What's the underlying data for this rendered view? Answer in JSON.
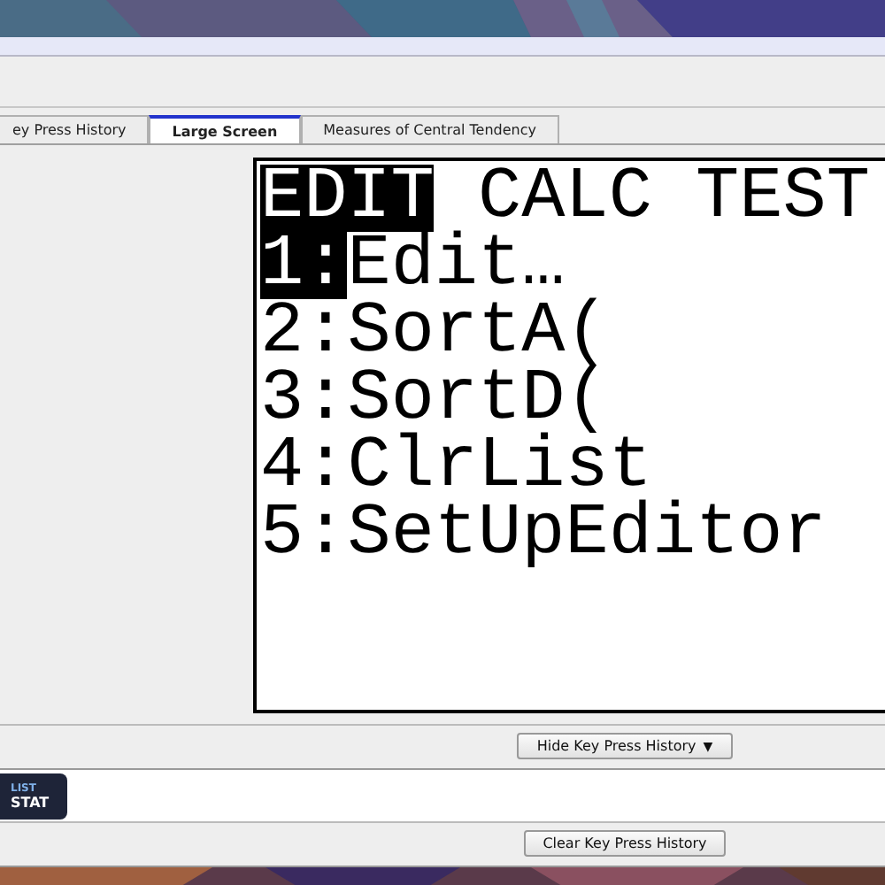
{
  "tabs": [
    {
      "label": "ey Press History",
      "selected": false
    },
    {
      "label": "Large Screen",
      "selected": true
    },
    {
      "label": "Measures of Central Tendency",
      "selected": false
    }
  ],
  "screen": {
    "menus": [
      {
        "label": "EDIT",
        "selected": true
      },
      {
        "label": "CALC",
        "selected": false
      },
      {
        "label": "TEST",
        "selected": false
      }
    ],
    "items": [
      {
        "number": "1:",
        "label": "Edit…",
        "selected": true
      },
      {
        "number": "2:",
        "label": "SortA(",
        "selected": false
      },
      {
        "number": "3:",
        "label": "SortD(",
        "selected": false
      },
      {
        "number": "4:",
        "label": "ClrList",
        "selected": false
      },
      {
        "number": "5:",
        "label": "SetUpEditor",
        "selected": false
      }
    ]
  },
  "hide_button": {
    "label": "Hide Key Press History",
    "icon": "▼"
  },
  "key_history": [
    {
      "second": "LIST",
      "primary": "STAT"
    }
  ],
  "clear_button": {
    "label": "Clear Key Press History"
  }
}
